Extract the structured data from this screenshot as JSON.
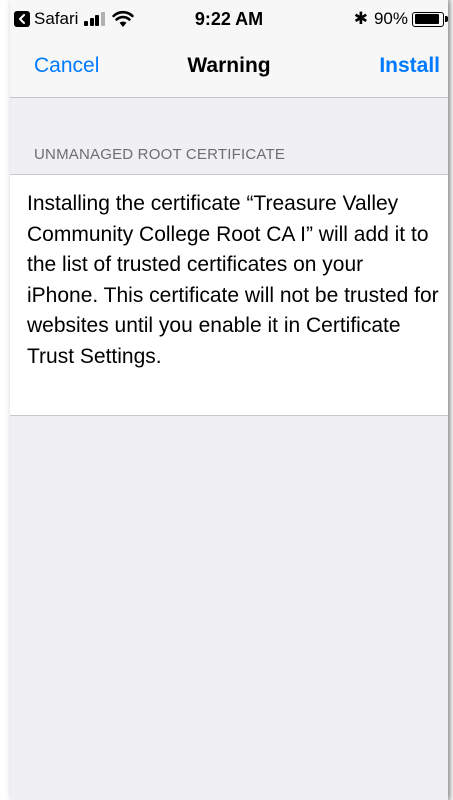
{
  "status_bar": {
    "back_app": "Safari",
    "time": "9:22 AM",
    "bluetooth": "✱",
    "battery_percent": "90%",
    "battery_level": 0.9
  },
  "nav": {
    "cancel_label": "Cancel",
    "title": "Warning",
    "install_label": "Install"
  },
  "section": {
    "header": "UNMANAGED ROOT CERTIFICATE",
    "body": "Installing the certificate “Treasure Valley Community College Root CA I” will add it to the list of trusted certificates on your iPhone. This certificate will not be trusted for websites until you enable it in Certificate Trust Settings."
  },
  "colors": {
    "accent": "#007aff",
    "background": "#efeff4",
    "header_text": "#6d6d72"
  },
  "icons": {
    "back_app": "back-arrow-icon",
    "signal": "cellular-signal-icon",
    "wifi": "wifi-icon",
    "bluetooth": "bluetooth-icon",
    "battery": "battery-icon"
  }
}
